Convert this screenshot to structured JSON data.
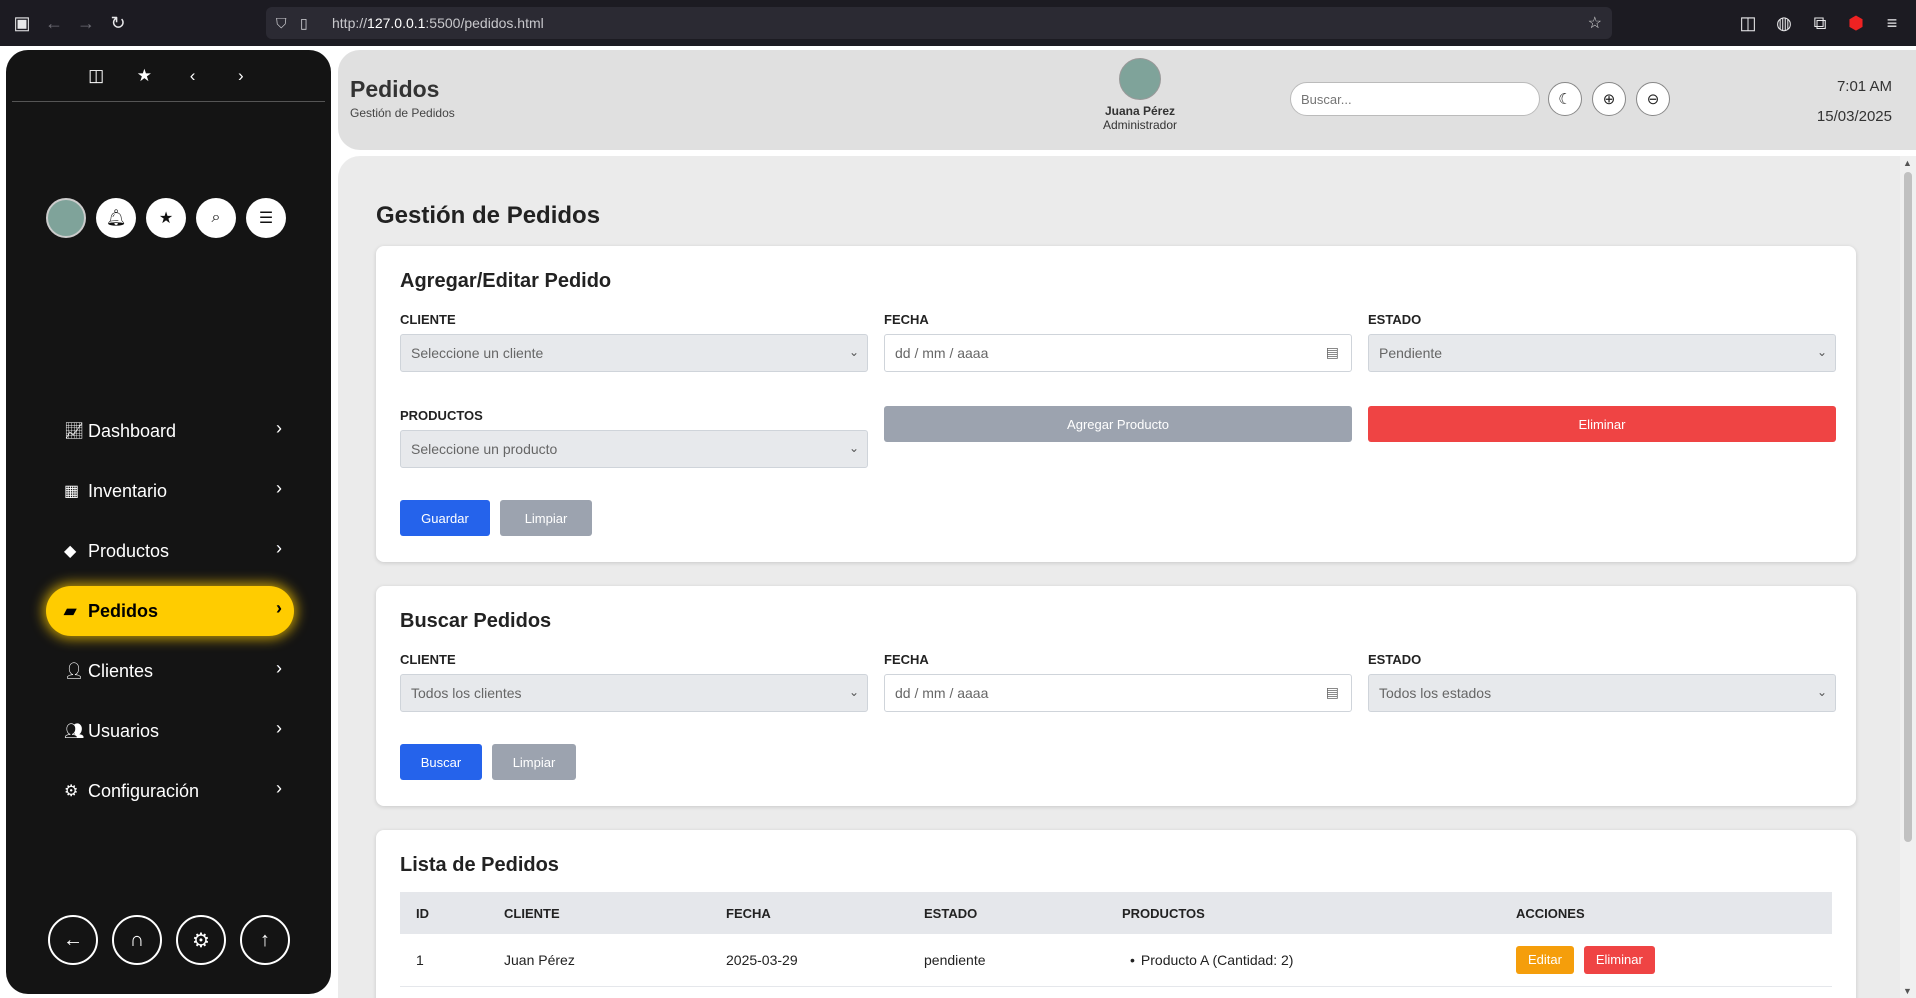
{
  "browser": {
    "url_prefix": "http://",
    "url_host": "127.0.0.1",
    "url_rest": ":5500/pedidos.html"
  },
  "sidebar": {
    "items": [
      {
        "label": "Dashboard",
        "icon": "chart-line-icon"
      },
      {
        "label": "Inventario",
        "icon": "calendar-icon"
      },
      {
        "label": "Productos",
        "icon": "tag-icon"
      },
      {
        "label": "Pedidos",
        "icon": "truck-icon",
        "active": true
      },
      {
        "label": "Clientes",
        "icon": "user-icon"
      },
      {
        "label": "Usuarios",
        "icon": "users-icon"
      },
      {
        "label": "Configuración",
        "icon": "gears-icon"
      }
    ],
    "accent": "#ffcc00"
  },
  "header": {
    "title": "Pedidos",
    "subtitle": "Gestión de Pedidos",
    "user_name": "Juana Pérez",
    "user_role": "Administrador",
    "search_placeholder": "Buscar...",
    "time": "7:01 AM",
    "date": "15/03/2025"
  },
  "main": {
    "page_title": "Gestión de Pedidos",
    "edit_card": {
      "title": "Agregar/Editar Pedido",
      "cliente_label": "CLIENTE",
      "cliente_value": "Seleccione un cliente",
      "fecha_label": "FECHA",
      "fecha_placeholder": "dd / mm / aaaa",
      "estado_label": "ESTADO",
      "estado_value": "Pendiente",
      "productos_label": "PRODUCTOS",
      "productos_value": "Seleccione un producto",
      "add_product_label": "Agregar Producto",
      "delete_label": "Eliminar",
      "save_label": "Guardar",
      "clear_label": "Limpiar"
    },
    "search_card": {
      "title": "Buscar Pedidos",
      "cliente_label": "CLIENTE",
      "cliente_value": "Todos los clientes",
      "fecha_label": "FECHA",
      "fecha_placeholder": "dd / mm / aaaa",
      "estado_label": "ESTADO",
      "estado_value": "Todos los estados",
      "search_label": "Buscar",
      "clear_label": "Limpiar"
    },
    "list_card": {
      "title": "Lista de Pedidos",
      "columns": [
        "ID",
        "CLIENTE",
        "FECHA",
        "ESTADO",
        "PRODUCTOS",
        "ACCIONES"
      ],
      "rows": [
        {
          "id": "1",
          "cliente": "Juan Pérez",
          "fecha": "2025-03-29",
          "estado": "pendiente",
          "productos": "Producto A (Cantidad: 2)",
          "edit": "Editar",
          "delete": "Eliminar"
        }
      ]
    }
  },
  "colors": {
    "primary": "#2563eb",
    "danger": "#ef4444",
    "warning": "#f59e0b",
    "muted": "#9ca3af"
  }
}
